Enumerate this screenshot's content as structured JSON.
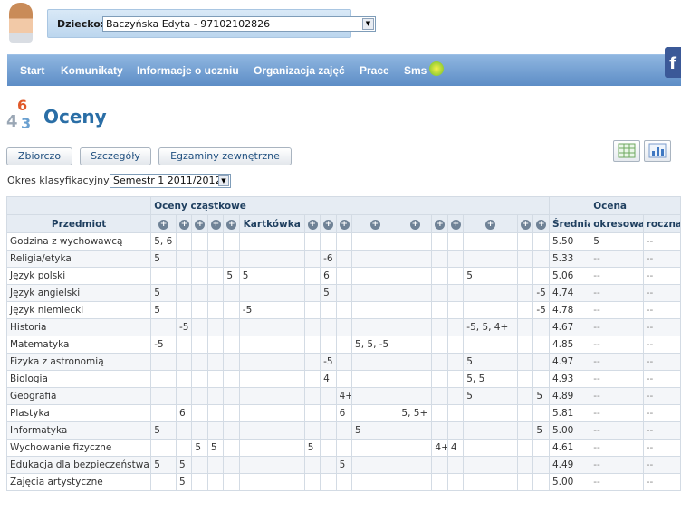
{
  "header": {
    "child_label": "Dziecko:",
    "child_value": "Baczyńska Edyta - 97102102826"
  },
  "nav": {
    "items": [
      "Start",
      "Komunikaty",
      "Informacje o uczniu",
      "Organizacja zajęć",
      "Prace",
      "Sms"
    ]
  },
  "page": {
    "title": "Oceny",
    "tabs": [
      "Zbiorczo",
      "Szczegóły",
      "Egzaminy zewnętrzne"
    ],
    "period_label": "Okres klasyfikacyjny:",
    "period_value": "Semestr 1 2011/2012"
  },
  "table": {
    "group_partial": "Oceny cząstkowe",
    "group_final": "Ocena",
    "subject_header": "Przedmiot",
    "kartkowka_header": "Kartkówka",
    "avg_header": "Średnia",
    "semester_header": "okresowa",
    "annual_header": "roczna",
    "rows": [
      {
        "subject": "Godzina z wychowawcą",
        "grades": [
          "5, 6",
          "",
          "",
          "",
          "",
          "",
          "",
          "",
          "",
          "",
          "",
          "",
          "",
          "",
          "",
          ""
        ],
        "avg": "5.50",
        "semester": "5",
        "annual": "--"
      },
      {
        "subject": "Religia/etyka",
        "grades": [
          "5",
          "",
          "",
          "",
          "",
          "",
          "",
          "-6",
          "",
          "",
          "",
          "",
          "",
          "",
          "",
          ""
        ],
        "avg": "5.33",
        "semester": "--",
        "annual": "--"
      },
      {
        "subject": "Język polski",
        "grades": [
          "",
          "",
          "",
          "",
          "5",
          "5",
          "",
          "6",
          "",
          "",
          "",
          "",
          "",
          "5",
          "",
          ""
        ],
        "avg": "5.06",
        "semester": "--",
        "annual": "--"
      },
      {
        "subject": "Język angielski",
        "grades": [
          "5",
          "",
          "",
          "",
          "",
          "",
          "",
          "5",
          "",
          "",
          "",
          "",
          "",
          "",
          "",
          "-5"
        ],
        "avg": "4.74",
        "semester": "--",
        "annual": "--"
      },
      {
        "subject": "Język niemiecki",
        "grades": [
          "5",
          "",
          "",
          "",
          "",
          "-5",
          "",
          "",
          "",
          "",
          "",
          "",
          "",
          "",
          "",
          "-5"
        ],
        "avg": "4.78",
        "semester": "--",
        "annual": "--"
      },
      {
        "subject": "Historia",
        "grades": [
          "",
          "-5",
          "",
          "",
          "",
          "",
          "",
          "",
          "",
          "",
          "",
          "",
          "",
          "-5, 5, 4+",
          "",
          ""
        ],
        "avg": "4.67",
        "semester": "--",
        "annual": "--"
      },
      {
        "subject": "Matematyka",
        "grades": [
          "-5",
          "",
          "",
          "",
          "",
          "",
          "",
          "",
          "",
          "5, 5, -5",
          "",
          "",
          "",
          "",
          "",
          ""
        ],
        "avg": "4.85",
        "semester": "--",
        "annual": "--"
      },
      {
        "subject": "Fizyka z astronomią",
        "grades": [
          "",
          "",
          "",
          "",
          "",
          "",
          "",
          "-5",
          "",
          "",
          "",
          "",
          "",
          "5",
          "",
          ""
        ],
        "avg": "4.97",
        "semester": "--",
        "annual": "--"
      },
      {
        "subject": "Biologia",
        "grades": [
          "",
          "",
          "",
          "",
          "",
          "",
          "",
          "4",
          "",
          "",
          "",
          "",
          "",
          "5, 5",
          "",
          ""
        ],
        "avg": "4.93",
        "semester": "--",
        "annual": "--"
      },
      {
        "subject": "Geografia",
        "grades": [
          "",
          "",
          "",
          "",
          "",
          "",
          "",
          "",
          "4+",
          "",
          "",
          "",
          "",
          "5",
          "",
          "5"
        ],
        "avg": "4.89",
        "semester": "--",
        "annual": "--"
      },
      {
        "subject": "Plastyka",
        "grades": [
          "",
          "6",
          "",
          "",
          "",
          "",
          "",
          "",
          "6",
          "",
          "5, 5+",
          "",
          "",
          "",
          "",
          ""
        ],
        "avg": "5.81",
        "semester": "--",
        "annual": "--"
      },
      {
        "subject": "Informatyka",
        "grades": [
          "5",
          "",
          "",
          "",
          "",
          "",
          "",
          "",
          "",
          "5",
          "",
          "",
          "",
          "",
          "",
          "5"
        ],
        "avg": "5.00",
        "semester": "--",
        "annual": "--"
      },
      {
        "subject": "Wychowanie fizyczne",
        "grades": [
          "",
          "",
          "5",
          "5",
          "",
          "",
          "5",
          "",
          "",
          "",
          "",
          "4+",
          "4",
          "",
          "",
          ""
        ],
        "avg": "4.61",
        "semester": "--",
        "annual": "--"
      },
      {
        "subject": "Edukacja dla bezpieczeństwa",
        "grades": [
          "5",
          "5",
          "",
          "",
          "",
          "",
          "",
          "",
          "5",
          "",
          "",
          "",
          "",
          "",
          "",
          ""
        ],
        "avg": "4.49",
        "semester": "--",
        "annual": "--"
      },
      {
        "subject": "Zajęcia artystyczne",
        "grades": [
          "",
          "5",
          "",
          "",
          "",
          "",
          "",
          "",
          "",
          "",
          "",
          "",
          "",
          "",
          "",
          ""
        ],
        "avg": "5.00",
        "semester": "--",
        "annual": "--"
      }
    ]
  },
  "colors": {
    "nav_top": "#8fb6e0",
    "nav_bottom": "#5d8dc6",
    "title": "#2a6ea6",
    "header_bg": "#e6ecf3"
  }
}
